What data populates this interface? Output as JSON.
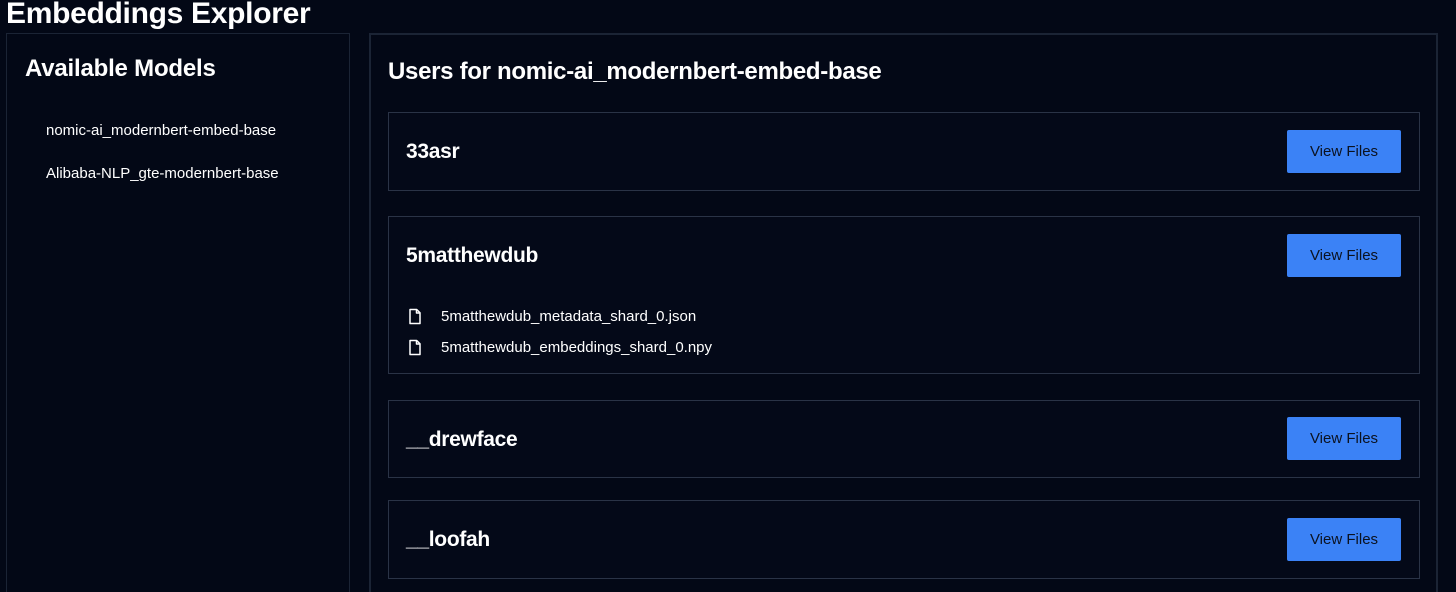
{
  "app": {
    "title": "Embeddings Explorer"
  },
  "sidebar": {
    "title": "Available Models",
    "models": [
      {
        "label": "nomic-ai_modernbert-embed-base"
      },
      {
        "label": "Alibaba-NLP_gte-modernbert-base"
      }
    ]
  },
  "main": {
    "title": "Users for nomic-ai_modernbert-embed-base",
    "users": [
      {
        "name": "33asr",
        "button_label": "View Files",
        "files": []
      },
      {
        "name": "5matthewdub",
        "button_label": "View Files",
        "files": [
          {
            "name": "5matthewdub_metadata_shard_0.json",
            "icon": "file-icon"
          },
          {
            "name": "5matthewdub_embeddings_shard_0.npy",
            "icon": "file-icon"
          }
        ]
      },
      {
        "name": "__drewface",
        "button_label": "View Files",
        "files": []
      },
      {
        "name": "__loofah",
        "button_label": "View Files",
        "files": []
      }
    ]
  },
  "colors": {
    "background": "#030816",
    "border": "#2a3346",
    "button": "#3b82f6",
    "button_text": "#0b1220",
    "text": "#ffffff"
  }
}
